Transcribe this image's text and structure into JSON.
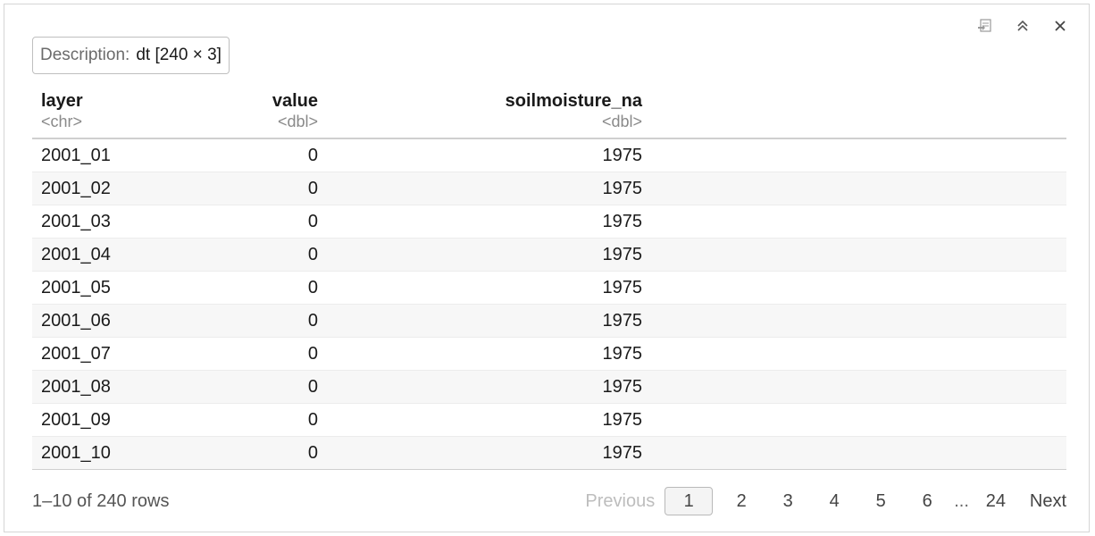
{
  "toolbar": {
    "icons": [
      "export-icon",
      "collapse-icon",
      "close-icon"
    ]
  },
  "description": {
    "label": "Description:",
    "value": "dt [240 × 3]"
  },
  "table": {
    "columns": [
      {
        "name": "layer",
        "type": "<chr>"
      },
      {
        "name": "value",
        "type": "<dbl>"
      },
      {
        "name": "soilmoisture_na",
        "type": "<dbl>"
      }
    ],
    "rows": [
      [
        "2001_01",
        "0",
        "1975"
      ],
      [
        "2001_02",
        "0",
        "1975"
      ],
      [
        "2001_03",
        "0",
        "1975"
      ],
      [
        "2001_04",
        "0",
        "1975"
      ],
      [
        "2001_05",
        "0",
        "1975"
      ],
      [
        "2001_06",
        "0",
        "1975"
      ],
      [
        "2001_07",
        "0",
        "1975"
      ],
      [
        "2001_08",
        "0",
        "1975"
      ],
      [
        "2001_09",
        "0",
        "1975"
      ],
      [
        "2001_10",
        "0",
        "1975"
      ]
    ]
  },
  "footer": {
    "rows_info": "1–10 of 240 rows",
    "previous": "Previous",
    "pages": [
      "1",
      "2",
      "3",
      "4",
      "5",
      "6"
    ],
    "current_page": "1",
    "ellipsis": "...",
    "last_page": "24",
    "next": "Next"
  }
}
